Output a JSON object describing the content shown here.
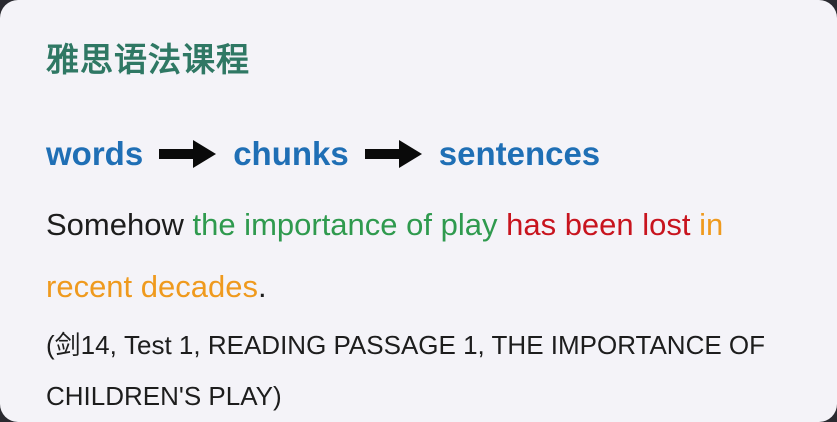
{
  "title": "雅思语法课程",
  "flow": {
    "words": "words",
    "chunks": "chunks",
    "sentences": "sentences"
  },
  "sentence": {
    "part1": "Somehow ",
    "part2": "the importance of play",
    "part3": " has been lost",
    "part4": " in recent decades",
    "part5": "."
  },
  "source": "(剑14, Test 1, READING PASSAGE 1, THE IMPORTANCE OF CHILDREN'S PLAY)",
  "colors": {
    "title": "#2f7864",
    "flow_words": "#1f6fb5",
    "subject": "#2f9a4e",
    "verb": "#c8141e",
    "adverbial": "#ef9a1e",
    "text": "#1d1d1d"
  }
}
